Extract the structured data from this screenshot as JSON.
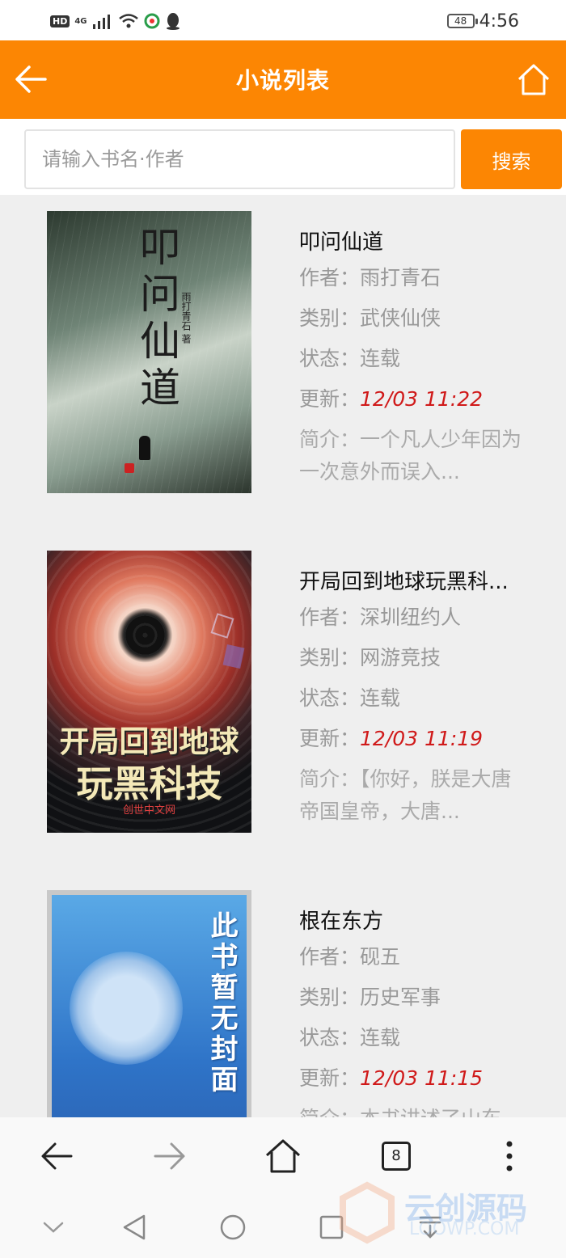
{
  "status_bar": {
    "hd": "HD",
    "network": "4G",
    "battery": "48",
    "time": "4:56"
  },
  "header": {
    "title": "小说列表",
    "back_icon": "arrow-left-icon",
    "home_icon": "home-icon"
  },
  "search": {
    "placeholder": "请输入书名·作者",
    "button_label": "搜索"
  },
  "labels": {
    "author": "作者：",
    "category": "类别：",
    "status": "状态：",
    "updated": "更新：",
    "intro": "简介："
  },
  "books": [
    {
      "title": "叩问仙道",
      "author": "雨打青石",
      "category": "武侠仙侠",
      "status": "连载",
      "updated": "12/03 11:22",
      "intro": "一个凡人少年因为一次意外而误入...",
      "cover_title": "叩问仙道",
      "cover_author": "雨打青石 著"
    },
    {
      "title": "开局回到地球玩黑科...",
      "author": "深圳纽约人",
      "category": "网游竞技",
      "status": "连载",
      "updated": "12/03 11:19",
      "intro": "【你好，朕是大唐帝国皇帝，大唐...",
      "cover_line1": "开局回到地球",
      "cover_line2": "玩黑科技",
      "cover_publisher": "创世中文网"
    },
    {
      "title": "根在东方",
      "author": "砚五",
      "category": "历史军事",
      "status": "连载",
      "updated": "12/03 11:15",
      "intro": "本书讲述了山东...",
      "cover_text": "此书暂无封面"
    }
  ],
  "browser_bar": {
    "tab_count": "8"
  },
  "watermark": {
    "text": "云创源码",
    "sub": "LOOWP.COM"
  },
  "colors": {
    "accent": "#fc8603",
    "update_time": "#d01a1a",
    "muted_text": "#999999"
  }
}
